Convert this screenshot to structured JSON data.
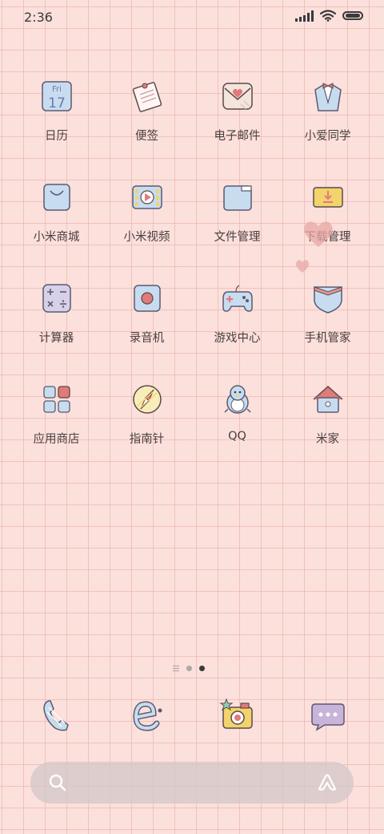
{
  "status_bar": {
    "time": "2:36",
    "icons": [
      "signal-icon",
      "wifi-icon",
      "battery-icon"
    ]
  },
  "apps": [
    {
      "label": "日历",
      "icon": "calendar-icon",
      "calendar_day": "Fri",
      "calendar_date": "17"
    },
    {
      "label": "便签",
      "icon": "notes-icon"
    },
    {
      "label": "电子邮件",
      "icon": "mail-icon"
    },
    {
      "label": "小爱同学",
      "icon": "assistant-icon"
    },
    {
      "label": "小米商城",
      "icon": "store-icon"
    },
    {
      "label": "小米视频",
      "icon": "video-icon"
    },
    {
      "label": "文件管理",
      "icon": "folder-icon"
    },
    {
      "label": "下载管理",
      "icon": "download-icon"
    },
    {
      "label": "计算器",
      "icon": "calculator-icon"
    },
    {
      "label": "录音机",
      "icon": "recorder-icon"
    },
    {
      "label": "游戏中心",
      "icon": "gamepad-icon"
    },
    {
      "label": "手机管家",
      "icon": "shield-icon"
    },
    {
      "label": "应用商店",
      "icon": "app-store-icon"
    },
    {
      "label": "指南针",
      "icon": "compass-icon"
    },
    {
      "label": "QQ",
      "icon": "penguin-icon"
    },
    {
      "label": "米家",
      "icon": "home-icon"
    }
  ],
  "page_indicator": {
    "pages": 3,
    "active_page": 3
  },
  "dock": [
    {
      "icon": "phone-icon"
    },
    {
      "icon": "browser-icon"
    },
    {
      "icon": "camera-icon"
    },
    {
      "icon": "messages-icon"
    }
  ],
  "search_bar": {
    "icons": [
      "search-icon",
      "assistant-icon"
    ]
  },
  "colors": {
    "background": "#fbe0dc",
    "icon_blue": "#c8dcf0",
    "icon_outline": "#5a4a4a",
    "accent_red": "#e27a7a"
  }
}
